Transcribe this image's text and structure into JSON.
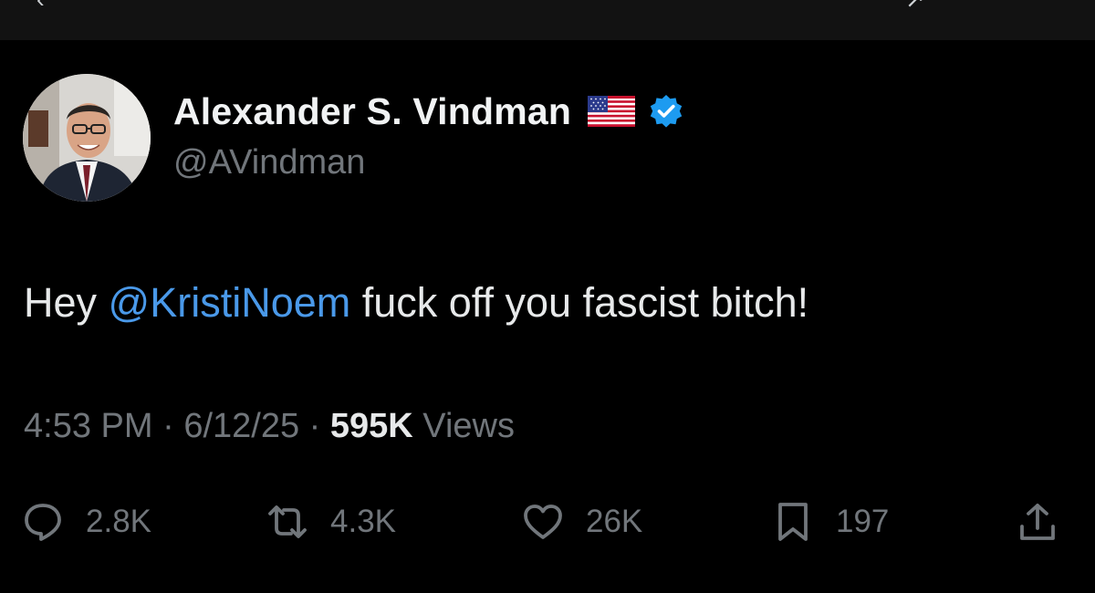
{
  "user": {
    "display_name": "Alexander S. Vindman",
    "flag_icon": "us-flag-icon",
    "verified_icon": "verified-badge-icon",
    "verified_color": "#1d9bf0",
    "handle": "@AVindman"
  },
  "tweet": {
    "text_before": "Hey ",
    "mention": "@KristiNoem",
    "text_after": " fuck off you fascist bitch!",
    "mention_color": "#4a99e9"
  },
  "meta": {
    "time": "4:53 PM",
    "sep1": " · ",
    "date": "6/12/25",
    "sep2": " · ",
    "views_count": "595K",
    "views_label": " Views"
  },
  "actions": {
    "reply": {
      "icon": "reply-icon",
      "count": "2.8K"
    },
    "repost": {
      "icon": "repost-icon",
      "count": "4.3K"
    },
    "like": {
      "icon": "heart-icon",
      "count": "26K"
    },
    "bookmark": {
      "icon": "bookmark-icon",
      "count": "197"
    },
    "share": {
      "icon": "share-icon"
    }
  }
}
